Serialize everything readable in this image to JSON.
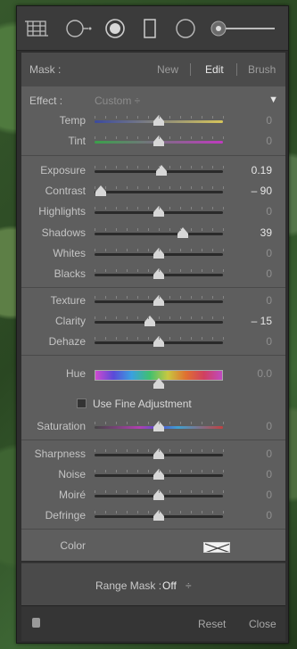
{
  "toolbar": {
    "tools": [
      {
        "name": "crop-overlay-icon"
      },
      {
        "name": "spot-removal-icon"
      },
      {
        "name": "red-eye-icon"
      },
      {
        "name": "graduated-filter-icon"
      },
      {
        "name": "radial-filter-icon"
      },
      {
        "name": "adjustment-brush-icon"
      }
    ]
  },
  "mask": {
    "label": "Mask :",
    "new_label": "New",
    "edit_label": "Edit",
    "brush_label": "Brush"
  },
  "effect": {
    "label": "Effect :",
    "value": "Custom ÷"
  },
  "sliders": {
    "temp": {
      "label": "Temp",
      "value": "0",
      "pos": 0.5
    },
    "tint": {
      "label": "Tint",
      "value": "0",
      "pos": 0.5
    },
    "exposure": {
      "label": "Exposure",
      "value": "0.19",
      "pos": 0.52
    },
    "contrast": {
      "label": "Contrast",
      "value": "– 90",
      "pos": 0.05
    },
    "highlights": {
      "label": "Highlights",
      "value": "0",
      "pos": 0.5
    },
    "shadows": {
      "label": "Shadows",
      "value": "39",
      "pos": 0.69
    },
    "whites": {
      "label": "Whites",
      "value": "0",
      "pos": 0.5
    },
    "blacks": {
      "label": "Blacks",
      "value": "0",
      "pos": 0.5
    },
    "texture": {
      "label": "Texture",
      "value": "0",
      "pos": 0.5
    },
    "clarity": {
      "label": "Clarity",
      "value": "– 15",
      "pos": 0.43
    },
    "dehaze": {
      "label": "Dehaze",
      "value": "0",
      "pos": 0.5
    },
    "hue": {
      "label": "Hue",
      "value": "0.0",
      "pos": 0.5
    },
    "saturation": {
      "label": "Saturation",
      "value": "0",
      "pos": 0.5
    },
    "sharpness": {
      "label": "Sharpness",
      "value": "0",
      "pos": 0.5
    },
    "noise": {
      "label": "Noise",
      "value": "0",
      "pos": 0.5
    },
    "moire": {
      "label": "Moiré",
      "value": "0",
      "pos": 0.5
    },
    "defringe": {
      "label": "Defringe",
      "value": "0",
      "pos": 0.5
    }
  },
  "fine_adjust": {
    "label": "Use Fine Adjustment"
  },
  "color": {
    "label": "Color"
  },
  "range_mask": {
    "label": "Range Mask :",
    "value": "Off",
    "arrow": "÷"
  },
  "footer": {
    "reset_label": "Reset",
    "close_label": "Close"
  }
}
